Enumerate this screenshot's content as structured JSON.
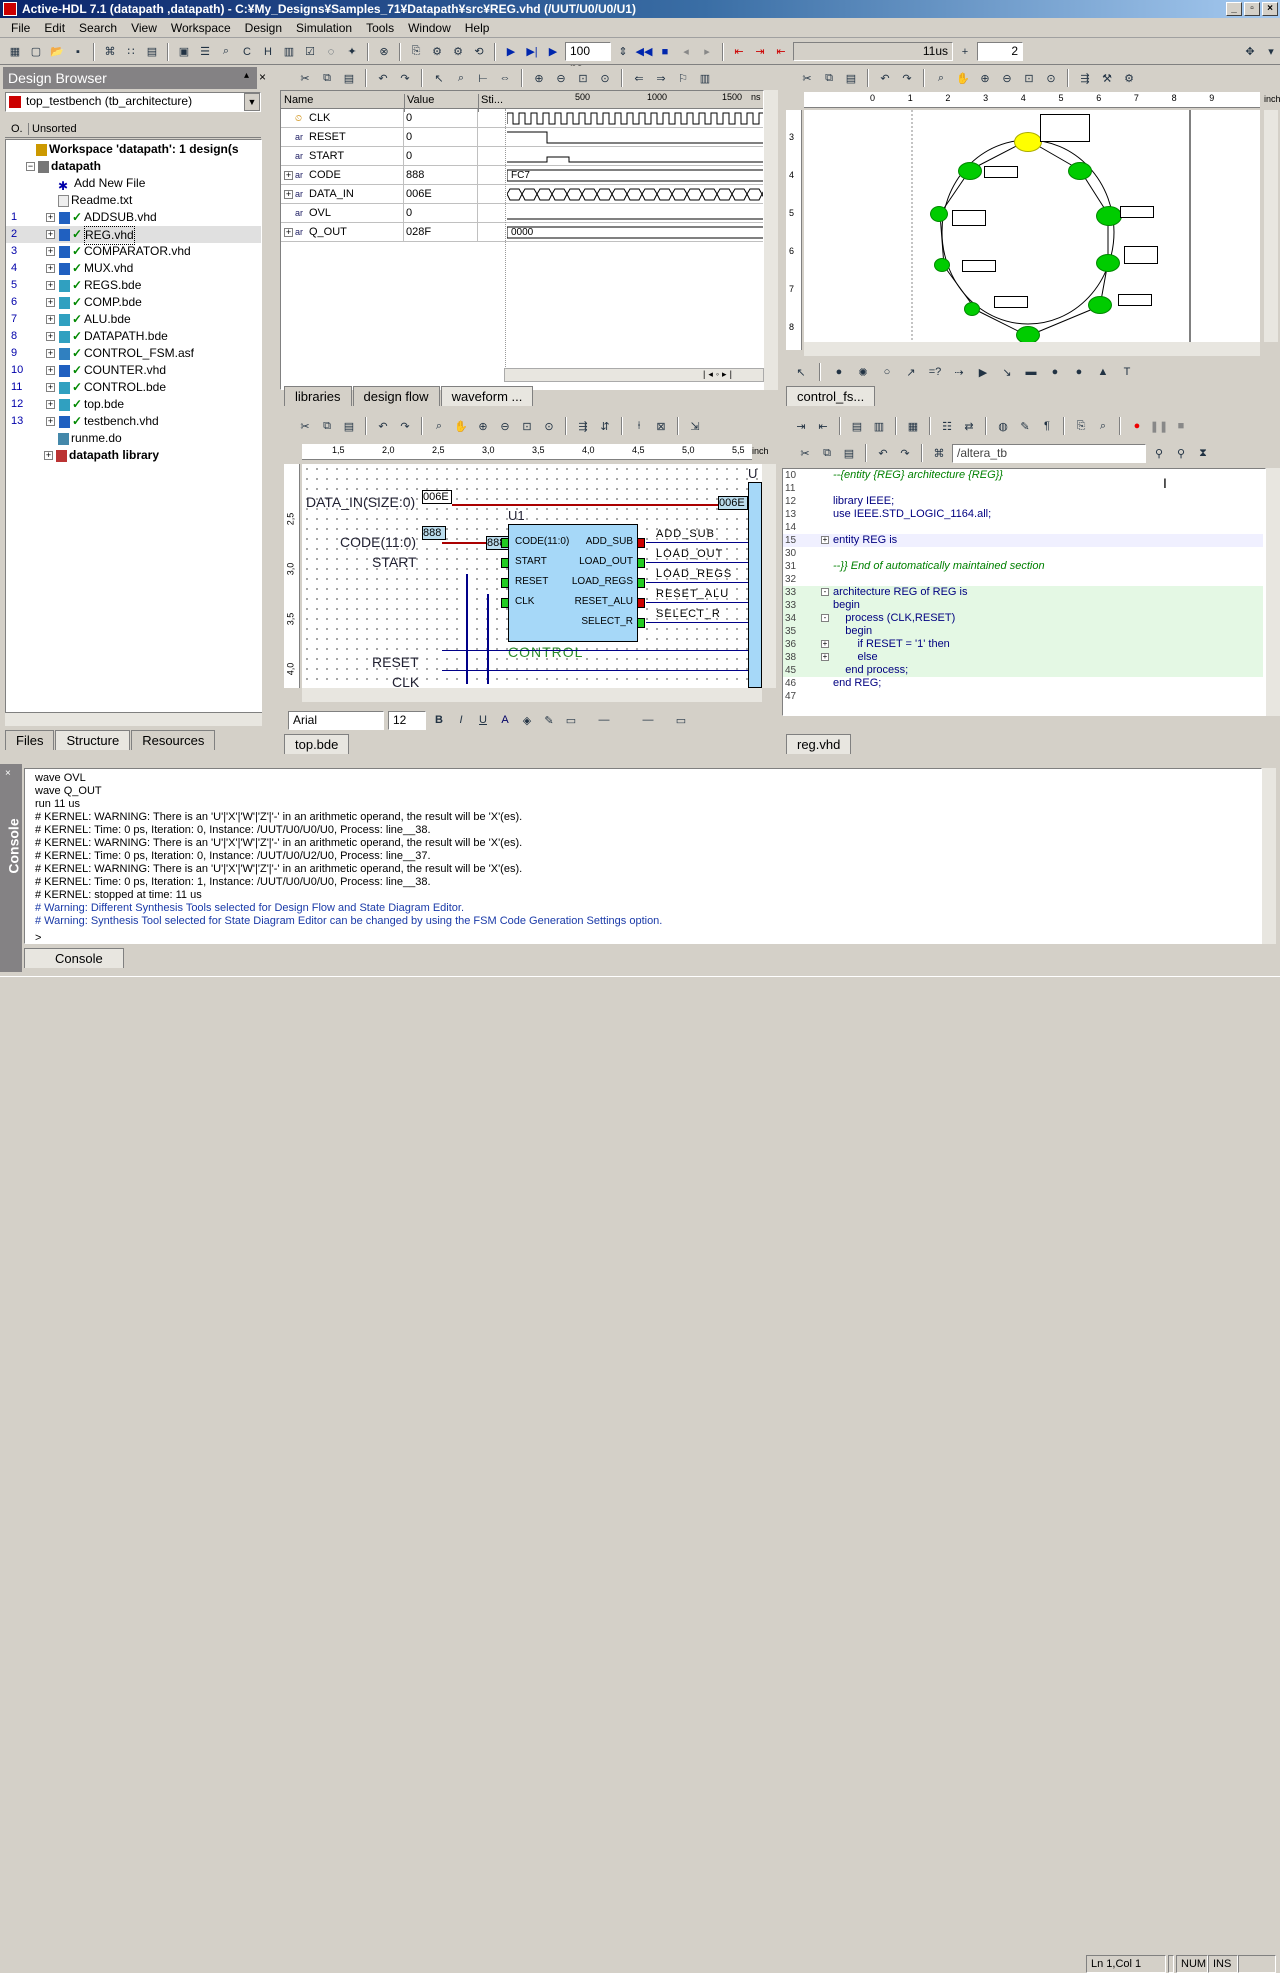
{
  "title": "Active-HDL 7.1 (datapath ,datapath) - C:¥My_Designs¥Samples_71¥Datapath¥src¥REG.vhd (/UUT/U0/U0/U1)",
  "menu": [
    "File",
    "Edit",
    "Search",
    "View",
    "Workspace",
    "Design",
    "Simulation",
    "Tools",
    "Window",
    "Help"
  ],
  "toolbar": {
    "runtime": "100 ns",
    "simtime": "11us",
    "counter": "2"
  },
  "design_browser": {
    "title": "Design Browser",
    "top_selector": "top_testbench (tb_architecture)",
    "col_o": "O.",
    "col_sort": "Unsorted",
    "workspace": "Workspace 'datapath': 1 design(s",
    "design": "datapath",
    "add_new": "Add New File",
    "readme": "Readme.txt",
    "files": [
      {
        "n": "1",
        "name": "ADDSUB.vhd"
      },
      {
        "n": "2",
        "name": "REG.vhd"
      },
      {
        "n": "3",
        "name": "COMPARATOR.vhd"
      },
      {
        "n": "4",
        "name": "MUX.vhd"
      },
      {
        "n": "5",
        "name": "REGS.bde"
      },
      {
        "n": "6",
        "name": "COMP.bde"
      },
      {
        "n": "7",
        "name": "ALU.bde"
      },
      {
        "n": "8",
        "name": "DATAPATH.bde"
      },
      {
        "n": "9",
        "name": "CONTROL_FSM.asf"
      },
      {
        "n": "10",
        "name": "COUNTER.vhd"
      },
      {
        "n": "11",
        "name": "CONTROL.bde"
      },
      {
        "n": "12",
        "name": "top.bde"
      },
      {
        "n": "13",
        "name": "testbench.vhd"
      }
    ],
    "runme": "runme.do",
    "library": "datapath library",
    "tabs": [
      "Files",
      "Structure",
      "Resources"
    ]
  },
  "waveform": {
    "headers": [
      "Name",
      "Value",
      "Sti..."
    ],
    "ruler": [
      "500",
      "1000",
      "1500"
    ],
    "ruler_unit": "ns",
    "signals": [
      {
        "name": "CLK",
        "value": "0"
      },
      {
        "name": "RESET",
        "value": "0"
      },
      {
        "name": "START",
        "value": "0"
      },
      {
        "name": "CODE",
        "value": "888",
        "wave": "FC7"
      },
      {
        "name": "DATA_IN",
        "value": "006E"
      },
      {
        "name": "OVL",
        "value": "0"
      },
      {
        "name": "Q_OUT",
        "value": "028F",
        "wave": "0000"
      }
    ],
    "tabs": [
      "libraries",
      "design flow",
      "waveform ..."
    ]
  },
  "fsm": {
    "ruler": [
      "0",
      "1",
      "2",
      "3",
      "4",
      "5",
      "6",
      "7",
      "8",
      "9"
    ],
    "ruler_unit": "inch",
    "vruler": [
      "3",
      "4",
      "5",
      "6",
      "7",
      "8"
    ],
    "tab": "control_fs..."
  },
  "schematic": {
    "ruler": [
      "1,5",
      "2,0",
      "2,5",
      "3,0",
      "3,5",
      "4,0",
      "4,5",
      "5,0",
      "5,5"
    ],
    "ruler_unit": "inch",
    "vruler": [
      "2,5",
      "3,0",
      "3,5",
      "4,0"
    ],
    "labels": {
      "data_in": "DATA_IN(SIZE:0)",
      "code": "CODE(11:0)",
      "start": "START",
      "reset": "RESET",
      "clk": "CLK",
      "u1": "U1",
      "u_right": "U",
      "control": "CONTROL",
      "bus_006e": "006E",
      "bus_006e2": "006E",
      "bus_888": "888",
      "bus_888b": "888"
    },
    "block_in": [
      "CODE(11:0)",
      "START",
      "RESET",
      "CLK"
    ],
    "block_out": [
      "ADD_SUB",
      "LOAD_OUT",
      "LOAD_REGS",
      "RESET_ALU",
      "SELECT_R"
    ],
    "out_wires": [
      "ADD_SUB",
      "LOAD_OUT",
      "LOAD_REGS",
      "RESET_ALU",
      "SELECT_R"
    ],
    "font": "Arial",
    "size": "12",
    "tab": "top.bde"
  },
  "code": {
    "instance": "/altera_tb",
    "lines": [
      {
        "n": "10",
        "t": "--{entity {REG} architecture {REG}}",
        "c": "comment"
      },
      {
        "n": "11",
        "t": ""
      },
      {
        "n": "12",
        "t": "library IEEE;"
      },
      {
        "n": "13",
        "t": "use IEEE.STD_LOGIC_1164.all;"
      },
      {
        "n": "14",
        "t": ""
      },
      {
        "n": "15",
        "t": "entity REG is",
        "fold": "+"
      },
      {
        "n": "30",
        "t": ""
      },
      {
        "n": "31",
        "t": "--}} End of automatically maintained section",
        "c": "comment"
      },
      {
        "n": "32",
        "t": ""
      },
      {
        "n": "33",
        "t": "architecture REG of REG is",
        "fold": "-"
      },
      {
        "n": "33",
        "t": "begin"
      },
      {
        "n": "34",
        "t": "    process (CLK,RESET)",
        "fold": "-"
      },
      {
        "n": "35",
        "t": "    begin"
      },
      {
        "n": "36",
        "t": "        if RESET = '1' then",
        "fold": "+"
      },
      {
        "n": "38",
        "t": "        else",
        "fold": "+"
      },
      {
        "n": "45",
        "t": "    end process;"
      },
      {
        "n": "46",
        "t": "end REG;"
      },
      {
        "n": "47",
        "t": ""
      }
    ],
    "tab": "reg.vhd"
  },
  "console": {
    "title": "Console",
    "lines": [
      {
        "t": "wave OVL"
      },
      {
        "t": "wave Q_OUT"
      },
      {
        "t": "run 11 us"
      },
      {
        "t": "# KERNEL: WARNING: There is an 'U'|'X'|'W'|'Z'|'-' in an arithmetic operand, the result will be 'X'(es)."
      },
      {
        "t": "# KERNEL: Time: 0 ps,  Iteration: 0,  Instance: /UUT/U0/U0/U0,  Process: line__38."
      },
      {
        "t": "# KERNEL: WARNING: There is an 'U'|'X'|'W'|'Z'|'-' in an arithmetic operand, the result will be 'X'(es)."
      },
      {
        "t": "# KERNEL: Time: 0 ps,  Iteration: 0,  Instance: /UUT/U0/U2/U0,  Process: line__37."
      },
      {
        "t": "# KERNEL: WARNING: There is an 'U'|'X'|'W'|'Z'|'-' in an arithmetic operand, the result will be 'X'(es)."
      },
      {
        "t": "# KERNEL: Time: 0 ps,  Iteration: 1,  Instance: /UUT/U0/U0/U0,  Process: line__38."
      },
      {
        "t": "# KERNEL: stopped at time: 11 us"
      },
      {
        "t": "# Warning: Different Synthesis Tools selected for Design Flow and State Diagram Editor.",
        "c": "warn"
      },
      {
        "t": "# Warning: Synthesis Tool selected for State Diagram Editor can be changed by using the FSM Code Generation Settings option.",
        "c": "warn"
      }
    ],
    "prompt": ">",
    "tab": "Console"
  },
  "status": {
    "pos": "Ln 1,Col 1",
    "num": "NUM",
    "ins": "INS"
  },
  "colors": {
    "title": "#0a246a",
    "state": "#00cc00",
    "bus": "#aa0000",
    "block": "#a6d8f8"
  }
}
